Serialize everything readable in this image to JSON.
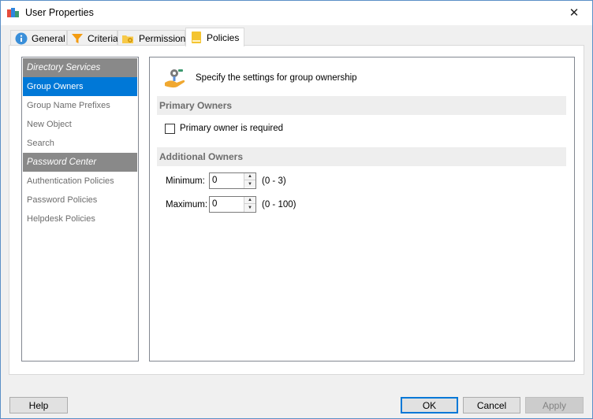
{
  "window": {
    "title": "User Properties",
    "close_glyph": "✕",
    "app_icon": "app-icon"
  },
  "tabs": [
    {
      "label": "General",
      "icon": "info-icon"
    },
    {
      "label": "Criteria",
      "icon": "filter-icon"
    },
    {
      "label": "Permissions",
      "icon": "folder-key-icon"
    },
    {
      "label": "Policies",
      "icon": "policy-book-icon",
      "active": true
    }
  ],
  "nav": {
    "items": [
      {
        "label": "Directory Services",
        "type": "header"
      },
      {
        "label": "Group Owners",
        "type": "item",
        "selected": true
      },
      {
        "label": "Group Name Prefixes",
        "type": "item"
      },
      {
        "label": "New Object",
        "type": "item"
      },
      {
        "label": "Search",
        "type": "item"
      },
      {
        "label": "Password Center",
        "type": "header"
      },
      {
        "label": "Authentication Policies",
        "type": "item"
      },
      {
        "label": "Password Policies",
        "type": "item"
      },
      {
        "label": "Helpdesk Policies",
        "type": "item"
      }
    ]
  },
  "content": {
    "intro": "Specify the settings for group ownership",
    "primary_owners": {
      "heading": "Primary Owners",
      "checkbox_label": "Primary owner is required",
      "checked": false
    },
    "additional_owners": {
      "heading": "Additional Owners",
      "minimum": {
        "label": "Minimum:",
        "value": "0",
        "range": "(0 - 3)"
      },
      "maximum": {
        "label": "Maximum:",
        "value": "0",
        "range": "(0 - 100)"
      }
    }
  },
  "buttons": {
    "help": "Help",
    "ok": "OK",
    "cancel": "Cancel",
    "apply": "Apply"
  },
  "colors": {
    "selection": "#0078d7",
    "nav_header": "#898989",
    "window_border": "#5b8fc7"
  }
}
